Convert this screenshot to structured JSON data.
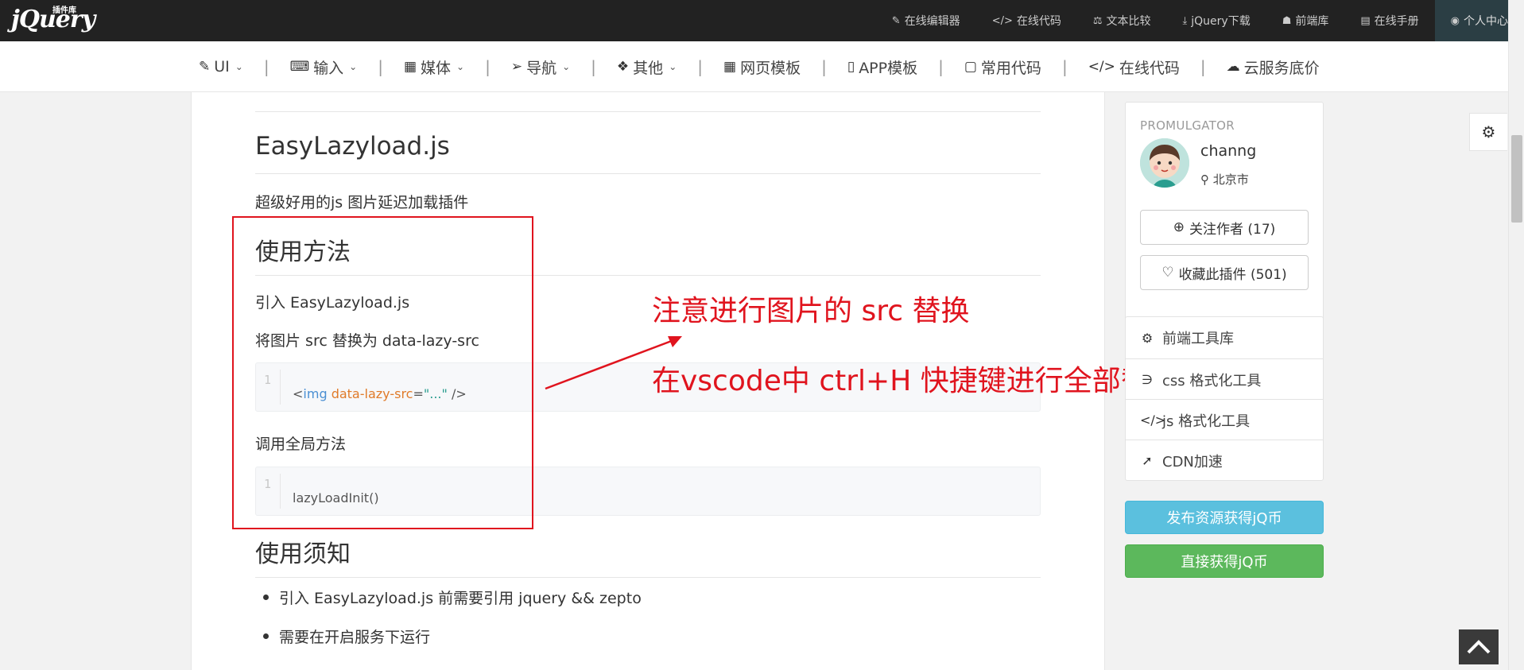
{
  "logo": {
    "text": "jQuery",
    "sub": "插件库"
  },
  "topnav": [
    {
      "icon": "edit-icon",
      "glyph": "✎",
      "label": "在线编辑器"
    },
    {
      "icon": "code-icon",
      "glyph": "</>",
      "label": "在线代码"
    },
    {
      "icon": "balance-icon",
      "glyph": "⚖",
      "label": "文本比较"
    },
    {
      "icon": "download-icon",
      "glyph": "⤓",
      "label": "jQuery下载"
    },
    {
      "icon": "user-secret-icon",
      "glyph": "☗",
      "label": "前端库"
    },
    {
      "icon": "book-icon",
      "glyph": "▤",
      "label": "在线手册"
    },
    {
      "icon": "lock-icon",
      "glyph": "🔒",
      "label": "个人中心"
    }
  ],
  "mainnav": [
    {
      "icon": "paintbrush-icon",
      "glyph": "🖌",
      "label": "UI",
      "dropdown": true
    },
    {
      "icon": "keyboard-icon",
      "glyph": "⌨",
      "label": "输入",
      "dropdown": true
    },
    {
      "icon": "film-icon",
      "glyph": "▦",
      "label": "媒体",
      "dropdown": true
    },
    {
      "icon": "paper-plane-icon",
      "glyph": "➢",
      "label": "导航",
      "dropdown": true
    },
    {
      "icon": "dropbox-icon",
      "glyph": "❖",
      "label": "其他",
      "dropdown": true
    },
    {
      "icon": "th-large-icon",
      "glyph": "▦",
      "label": "网页模板",
      "dropdown": false
    },
    {
      "icon": "mobile-icon",
      "glyph": "▯",
      "label": "APP模板",
      "dropdown": false
    },
    {
      "icon": "file-code-icon",
      "glyph": "▢",
      "label": "常用代码",
      "dropdown": false
    },
    {
      "icon": "code-icon",
      "glyph": "</>",
      "label": "在线代码",
      "dropdown": false
    },
    {
      "icon": "cloud-icon",
      "glyph": "☁",
      "label": "云服务底价",
      "dropdown": false
    }
  ],
  "article": {
    "title": "EasyLazyload.js",
    "description": "超级好用的js 图片延迟加载插件",
    "usage_heading": "使用方法",
    "step1": "引入 EasyLazyload.js",
    "step2": "将图片 src 替换为 data-lazy-src",
    "code1": {
      "line_no": "1",
      "open": "<",
      "tag": "img",
      "attr": "data-lazy-src",
      "eq": "=",
      "value": "\"...\"",
      "close": " />"
    },
    "step3": "调用全局方法",
    "code2": {
      "line_no": "1",
      "text": "lazyLoadInit()"
    },
    "notice_heading": "使用须知",
    "notes": [
      "引入 EasyLazyload.js 前需要引用 jquery && zepto",
      "需要在开启服务下运行"
    ]
  },
  "annotation": {
    "line1": "注意进行图片的 src 替换",
    "line2": "在vscode中 ctrl+H 快捷键进行全部替换",
    "color": "#e0141e"
  },
  "author": {
    "label": "PROMULGATOR",
    "name": "channg",
    "location": "北京市",
    "follow_label": "关注作者 (17)",
    "favorite_label": "收藏此插件 (501)"
  },
  "tools": [
    {
      "icon": "cogs-icon",
      "glyph": "⚙",
      "label": "前端工具库"
    },
    {
      "icon": "css3-icon",
      "glyph": "∋",
      "label": "css 格式化工具"
    },
    {
      "icon": "code-icon",
      "glyph": "</>",
      "label": "js 格式化工具"
    },
    {
      "icon": "rocket-icon",
      "glyph": "➚",
      "label": "CDN加速"
    }
  ],
  "buttons": {
    "publish": "发布资源获得jQ币",
    "get_coins": "直接获得jQ币"
  },
  "colors": {
    "topbar": "#222222",
    "accent_blue": "#5bc0de",
    "accent_green": "#5cb85c",
    "annotation_red": "#e0141e"
  }
}
